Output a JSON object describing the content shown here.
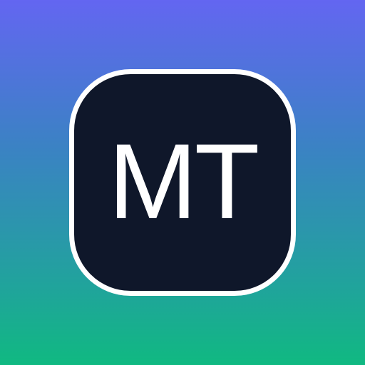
{
  "icon": {
    "initials": "MT"
  },
  "colors": {
    "gradient_top": "#6366f1",
    "gradient_bottom": "#10b981",
    "tile_background": "#0f172a",
    "tile_border": "#ffffff",
    "text": "#ffffff"
  }
}
